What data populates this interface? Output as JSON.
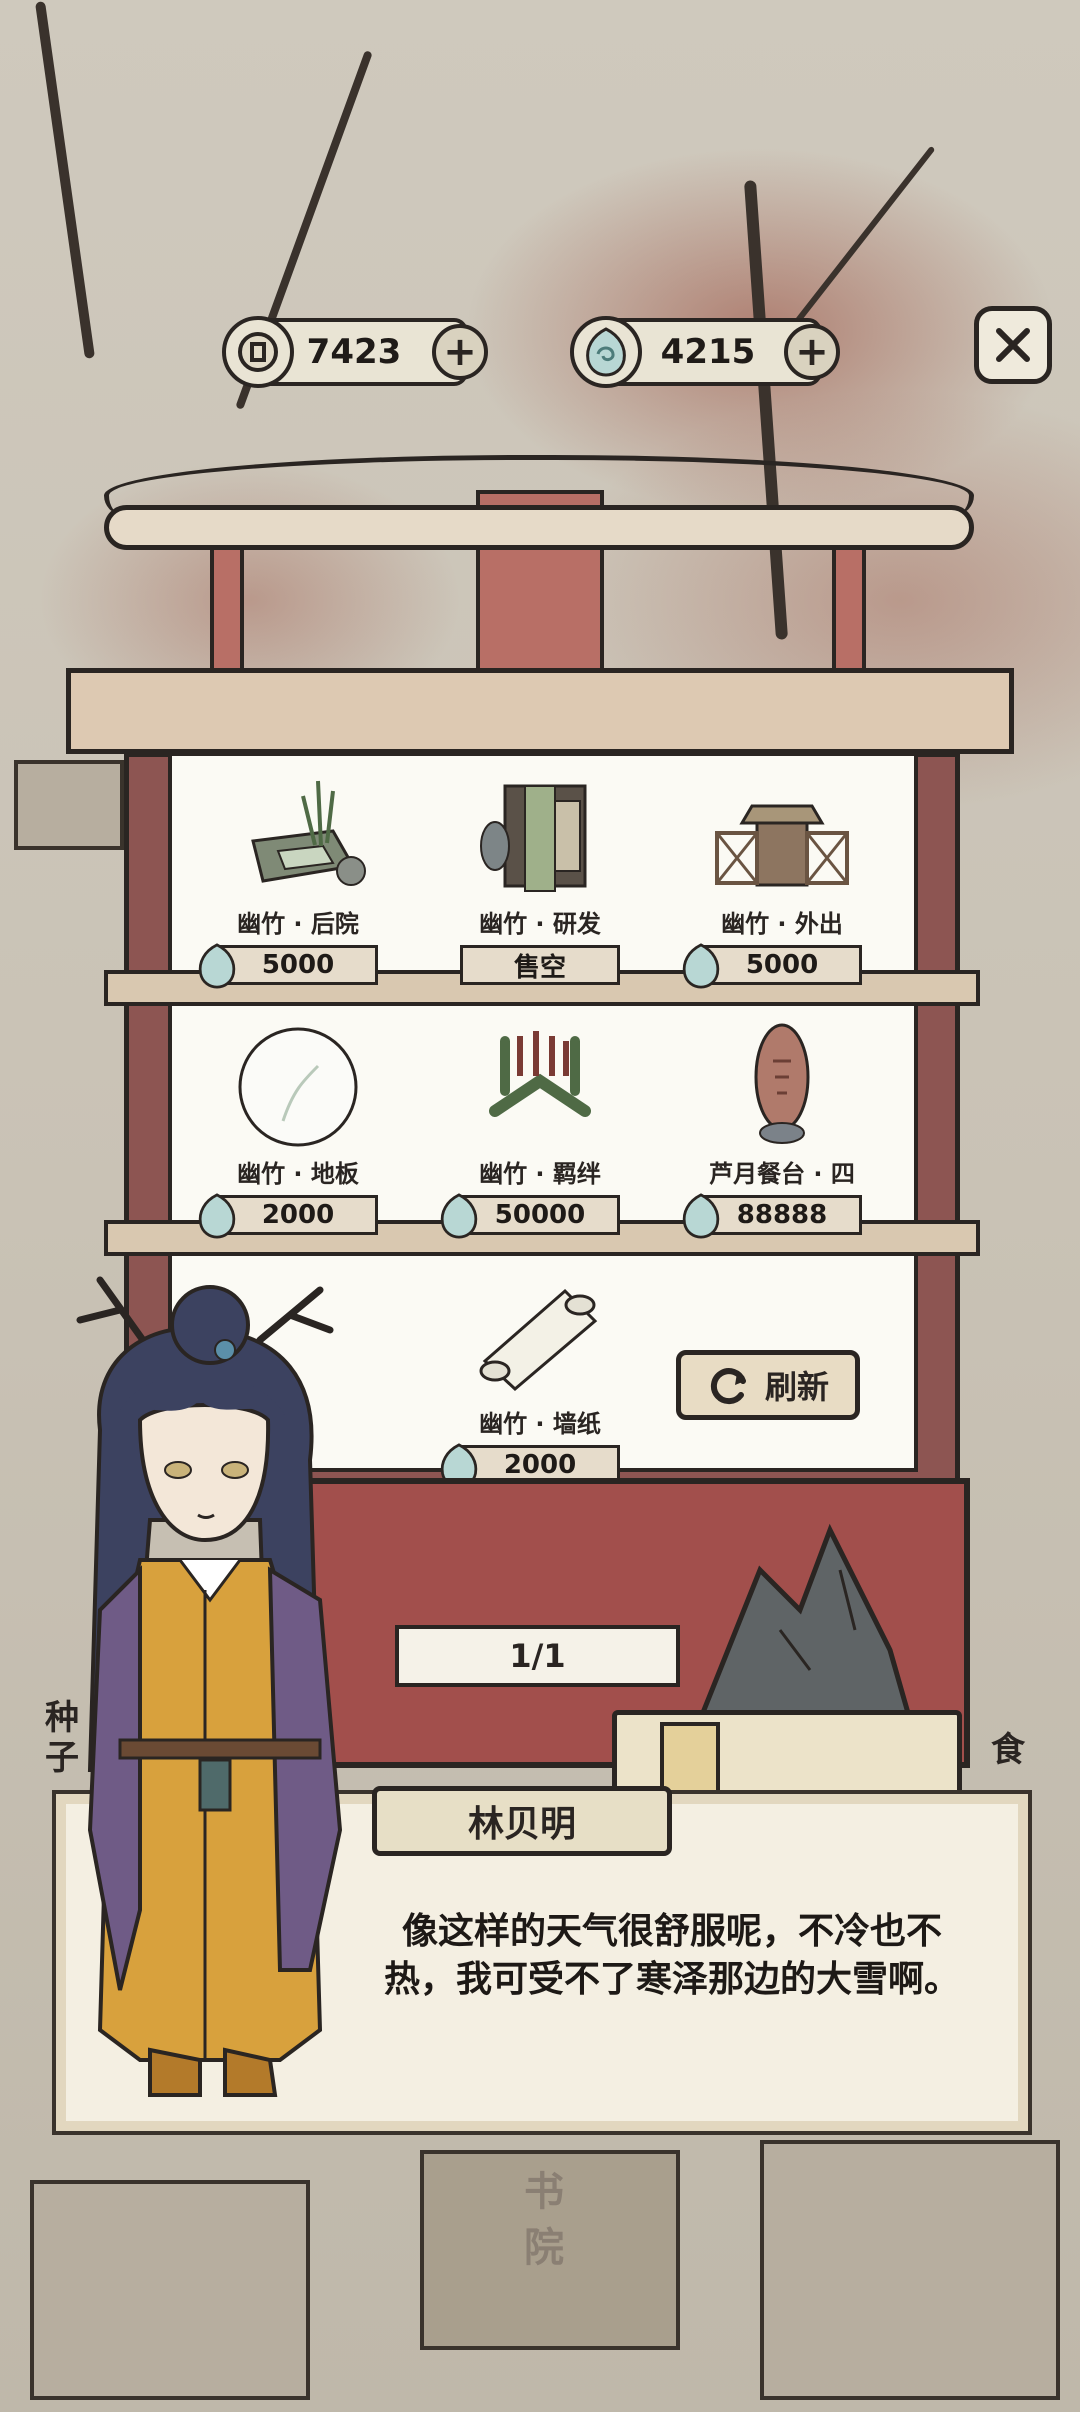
{
  "currencies": [
    {
      "name": "coin",
      "value": "7423"
    },
    {
      "name": "jade",
      "value": "4215"
    }
  ],
  "shop": {
    "items": [
      {
        "name": "幽竹 · 后院",
        "price": "5000"
      },
      {
        "name": "幽竹 · 研发",
        "price": "售空"
      },
      {
        "name": "幽竹 · 外出",
        "price": "5000"
      },
      {
        "name": "幽竹 · 地板",
        "price": "2000"
      },
      {
        "name": "幽竹 · 羁绊",
        "price": "50000"
      },
      {
        "name": "芦月餐台 · 四",
        "price": "88888"
      },
      {
        "name": "幽竹 · 墙纸",
        "price": "2000"
      }
    ],
    "refresh_label": "刷新",
    "page": "1/1"
  },
  "dialog": {
    "speaker": "林贝明",
    "text": "像这样的天气很舒服呢，不冷也不热，我可受不了寒泽那边的大雪啊。"
  },
  "side_labels": {
    "left": "种子",
    "right": "食"
  },
  "background_signs": {
    "academy": "书院"
  },
  "colors": {
    "frame_red": "#8d5552",
    "panel_red": "#a24f4c",
    "ink": "#2a2522",
    "paper": "#fbfaf4"
  }
}
